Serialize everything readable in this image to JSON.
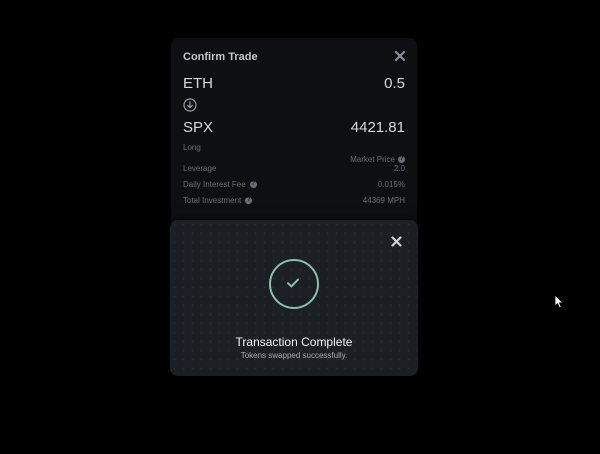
{
  "trade": {
    "title": "Confirm Trade",
    "from": {
      "asset": "ETH",
      "amount": "0.5"
    },
    "to": {
      "asset": "SPX",
      "position": "Long",
      "price": "4421.81",
      "price_label": "Market Price"
    },
    "details": [
      {
        "label": "Leverage",
        "value": "2.0",
        "help": false
      },
      {
        "label": "Daily Interest Fee",
        "value": "0.015%",
        "help": true
      },
      {
        "label": "Total Investment",
        "value": "44369 MPH",
        "help": true
      }
    ]
  },
  "modal": {
    "title": "Transaction Complete",
    "subtitle": "Tokens swapped successfully.",
    "accent": "#86c2aa"
  },
  "icons": [
    "close-icon",
    "arrow-down-circle-icon",
    "help-icon",
    "check-circle-icon",
    "cursor-icon"
  ]
}
